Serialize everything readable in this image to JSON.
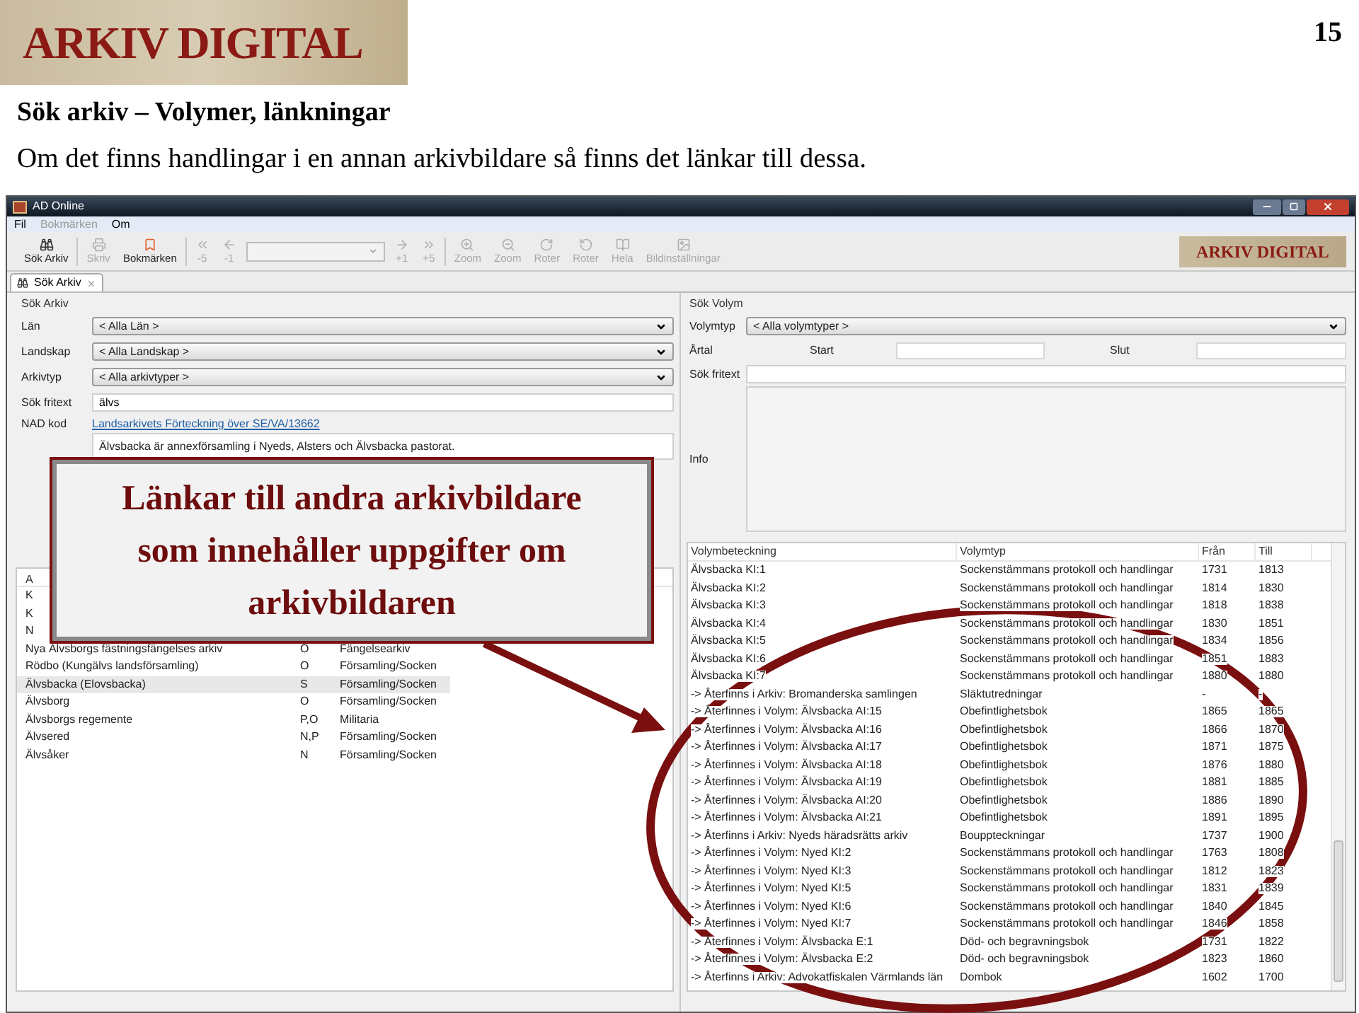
{
  "slide": {
    "logo": "ARKIV DIGITAL",
    "page_number": "15",
    "title": "Sök arkiv – Volymer, länkningar",
    "subtitle": "Om det finns handlingar i en annan arkivbildare så finns det länkar till dessa.",
    "callout": "Länkar till andra arkivbildare som innehåller uppgifter om arkivbildaren"
  },
  "window": {
    "title": "AD Online"
  },
  "menu": [
    {
      "label": "Fil",
      "disabled": false
    },
    {
      "label": "Bokmärken",
      "disabled": true
    },
    {
      "label": "Om",
      "disabled": false
    }
  ],
  "toolbar": [
    [
      {
        "kind": "button",
        "label": "Sök Arkiv",
        "disabled": false
      }
    ],
    [
      {
        "kind": "button",
        "label": "Skriv",
        "disabled": true
      },
      {
        "kind": "button",
        "label": "Bokmärken",
        "disabled": false
      }
    ],
    [
      {
        "kind": "button",
        "label": "-5",
        "disabled": true
      },
      {
        "kind": "button",
        "label": "-1",
        "disabled": true
      },
      {
        "kind": "combo",
        "disabled": true
      },
      {
        "kind": "button",
        "label": "+1",
        "disabled": true
      },
      {
        "kind": "button",
        "label": "+5",
        "disabled": true
      }
    ],
    [
      {
        "kind": "button",
        "label": "Zoom",
        "disabled": true
      },
      {
        "kind": "button",
        "label": "Zoom",
        "disabled": true
      },
      {
        "kind": "button",
        "label": "Roter",
        "disabled": true
      },
      {
        "kind": "button",
        "label": "Roter",
        "disabled": true
      },
      {
        "kind": "button",
        "label": "Hela",
        "disabled": true
      },
      {
        "kind": "button",
        "label": "Bildinställningar",
        "disabled": true
      }
    ]
  ],
  "toolbar_logo": "ARKIV DIGITAL",
  "tab": {
    "label": "Sök Arkiv"
  },
  "search_archive": {
    "heading": "Sök Arkiv",
    "fields": [
      {
        "kind": "select",
        "label": "Län",
        "value": "< Alla Län >"
      },
      {
        "kind": "select",
        "label": "Landskap",
        "value": "< Alla Landskap >"
      },
      {
        "kind": "select",
        "label": "Arkivtyp",
        "value": "< Alla arkivtyper >"
      },
      {
        "kind": "input",
        "label": "Sök fritext",
        "value": "älvs"
      },
      {
        "kind": "link",
        "label": "NAD kod",
        "value": "Landsarkivets Förteckning över SE/VA/13662"
      }
    ],
    "description": "Älvsbacka är annexförsamling i Nyeds, Alsters och Älvsbacka pastorat."
  },
  "archive_list": {
    "column_1": "A",
    "rows": [
      {
        "cells": [
          "K"
        ],
        "selected": false
      },
      {
        "cells": [
          "K"
        ],
        "selected": false
      },
      {
        "cells": [
          "N"
        ],
        "selected": false
      },
      {
        "cells": [
          "Nya Älvsborgs fästningsfängelses arkiv",
          "O",
          "Fängelsearkiv"
        ],
        "selected": false
      },
      {
        "cells": [
          "Rödbo (Kungälvs landsförsamling)",
          "O",
          "Församling/Socken"
        ],
        "selected": false
      },
      {
        "cells": [
          "Älvsbacka (Elovsbacka)",
          "S",
          "Församling/Socken"
        ],
        "selected": true
      },
      {
        "cells": [
          "Älvsborg",
          "O",
          "Församling/Socken"
        ],
        "selected": false
      },
      {
        "cells": [
          "Älvsborgs regemente",
          "P,O",
          "Militaria"
        ],
        "selected": false
      },
      {
        "cells": [
          "Älvsered",
          "N,P",
          "Församling/Socken"
        ],
        "selected": false
      },
      {
        "cells": [
          "Älvsåker",
          "N",
          "Församling/Socken"
        ],
        "selected": false
      }
    ]
  },
  "search_volume": {
    "heading": "Sök Volym",
    "type_label": "Volymtyp",
    "type_value": "< Alla volymtyper >",
    "year_label": "Årtal",
    "start_label": "Start",
    "end_label": "Slut",
    "freetext_label": "Sök fritext",
    "info_label": "Info"
  },
  "volume_table": {
    "columns": [
      "Volymbeteckning",
      "Volymtyp",
      "Från",
      "Till"
    ],
    "rows": [
      [
        "Älvsbacka KI:1",
        "Sockenstämmans protokoll och handlingar",
        "1731",
        "1813"
      ],
      [
        "Älvsbacka KI:2",
        "Sockenstämmans protokoll och handlingar",
        "1814",
        "1830"
      ],
      [
        "Älvsbacka KI:3",
        "Sockenstämmans protokoll och handlingar",
        "1818",
        "1838"
      ],
      [
        "Älvsbacka KI:4",
        "Sockenstämmans protokoll och handlingar",
        "1830",
        "1851"
      ],
      [
        "Älvsbacka KI:5",
        "Sockenstämmans protokoll och handlingar",
        "1834",
        "1856"
      ],
      [
        "Älvsbacka KI:6",
        "Sockenstämmans protokoll och handlingar",
        "1851",
        "1883"
      ],
      [
        "Älvsbacka KI:7",
        "Sockenstämmans protokoll och handlingar",
        "1880",
        "1880"
      ],
      [
        "-> Återfinns i Arkiv: Bromanderska samlingen",
        "Släktutredningar",
        "-",
        "-"
      ],
      [
        "-> Återfinnes i Volym: Älvsbacka AI:15",
        "Obefintlighetsbok",
        "1865",
        "1865"
      ],
      [
        "-> Återfinnes i Volym: Älvsbacka AI:16",
        "Obefintlighetsbok",
        "1866",
        "1870"
      ],
      [
        "-> Återfinnes i Volym: Älvsbacka AI:17",
        "Obefintlighetsbok",
        "1871",
        "1875"
      ],
      [
        "-> Återfinnes i Volym: Älvsbacka AI:18",
        "Obefintlighetsbok",
        "1876",
        "1880"
      ],
      [
        "-> Återfinnes i Volym: Älvsbacka AI:19",
        "Obefintlighetsbok",
        "1881",
        "1885"
      ],
      [
        "-> Återfinnes i Volym: Älvsbacka AI:20",
        "Obefintlighetsbok",
        "1886",
        "1890"
      ],
      [
        "-> Återfinnes i Volym: Älvsbacka AI:21",
        "Obefintlighetsbok",
        "1891",
        "1895"
      ],
      [
        "-> Återfinns i Arkiv: Nyeds häradsrätts arkiv",
        "Bouppteckningar",
        "1737",
        "1900"
      ],
      [
        "-> Återfinnes i Volym: Nyed KI:2",
        "Sockenstämmans protokoll och handlingar",
        "1763",
        "1808"
      ],
      [
        "-> Återfinnes i Volym: Nyed KI:3",
        "Sockenstämmans protokoll och handlingar",
        "1812",
        "1823"
      ],
      [
        "-> Återfinnes i Volym: Nyed KI:5",
        "Sockenstämmans protokoll och handlingar",
        "1831",
        "1839"
      ],
      [
        "-> Återfinnes i Volym: Nyed KI:6",
        "Sockenstämmans protokoll och handlingar",
        "1840",
        "1845"
      ],
      [
        "-> Återfinnes i Volym: Nyed KI:7",
        "Sockenstämmans protokoll och handlingar",
        "1846",
        "1858"
      ],
      [
        "-> Återfinnes i Volym: Älvsbacka E:1",
        "Död- och begravningsbok",
        "1731",
        "1822"
      ],
      [
        "-> Återfinnes i Volym: Älvsbacka E:2",
        "Död- och begravningsbok",
        "1823",
        "1860"
      ],
      [
        "-> Återfinns i Arkiv: Advokatfiskalen Värmlands län",
        "Dombok",
        "1602",
        "1700"
      ]
    ]
  }
}
